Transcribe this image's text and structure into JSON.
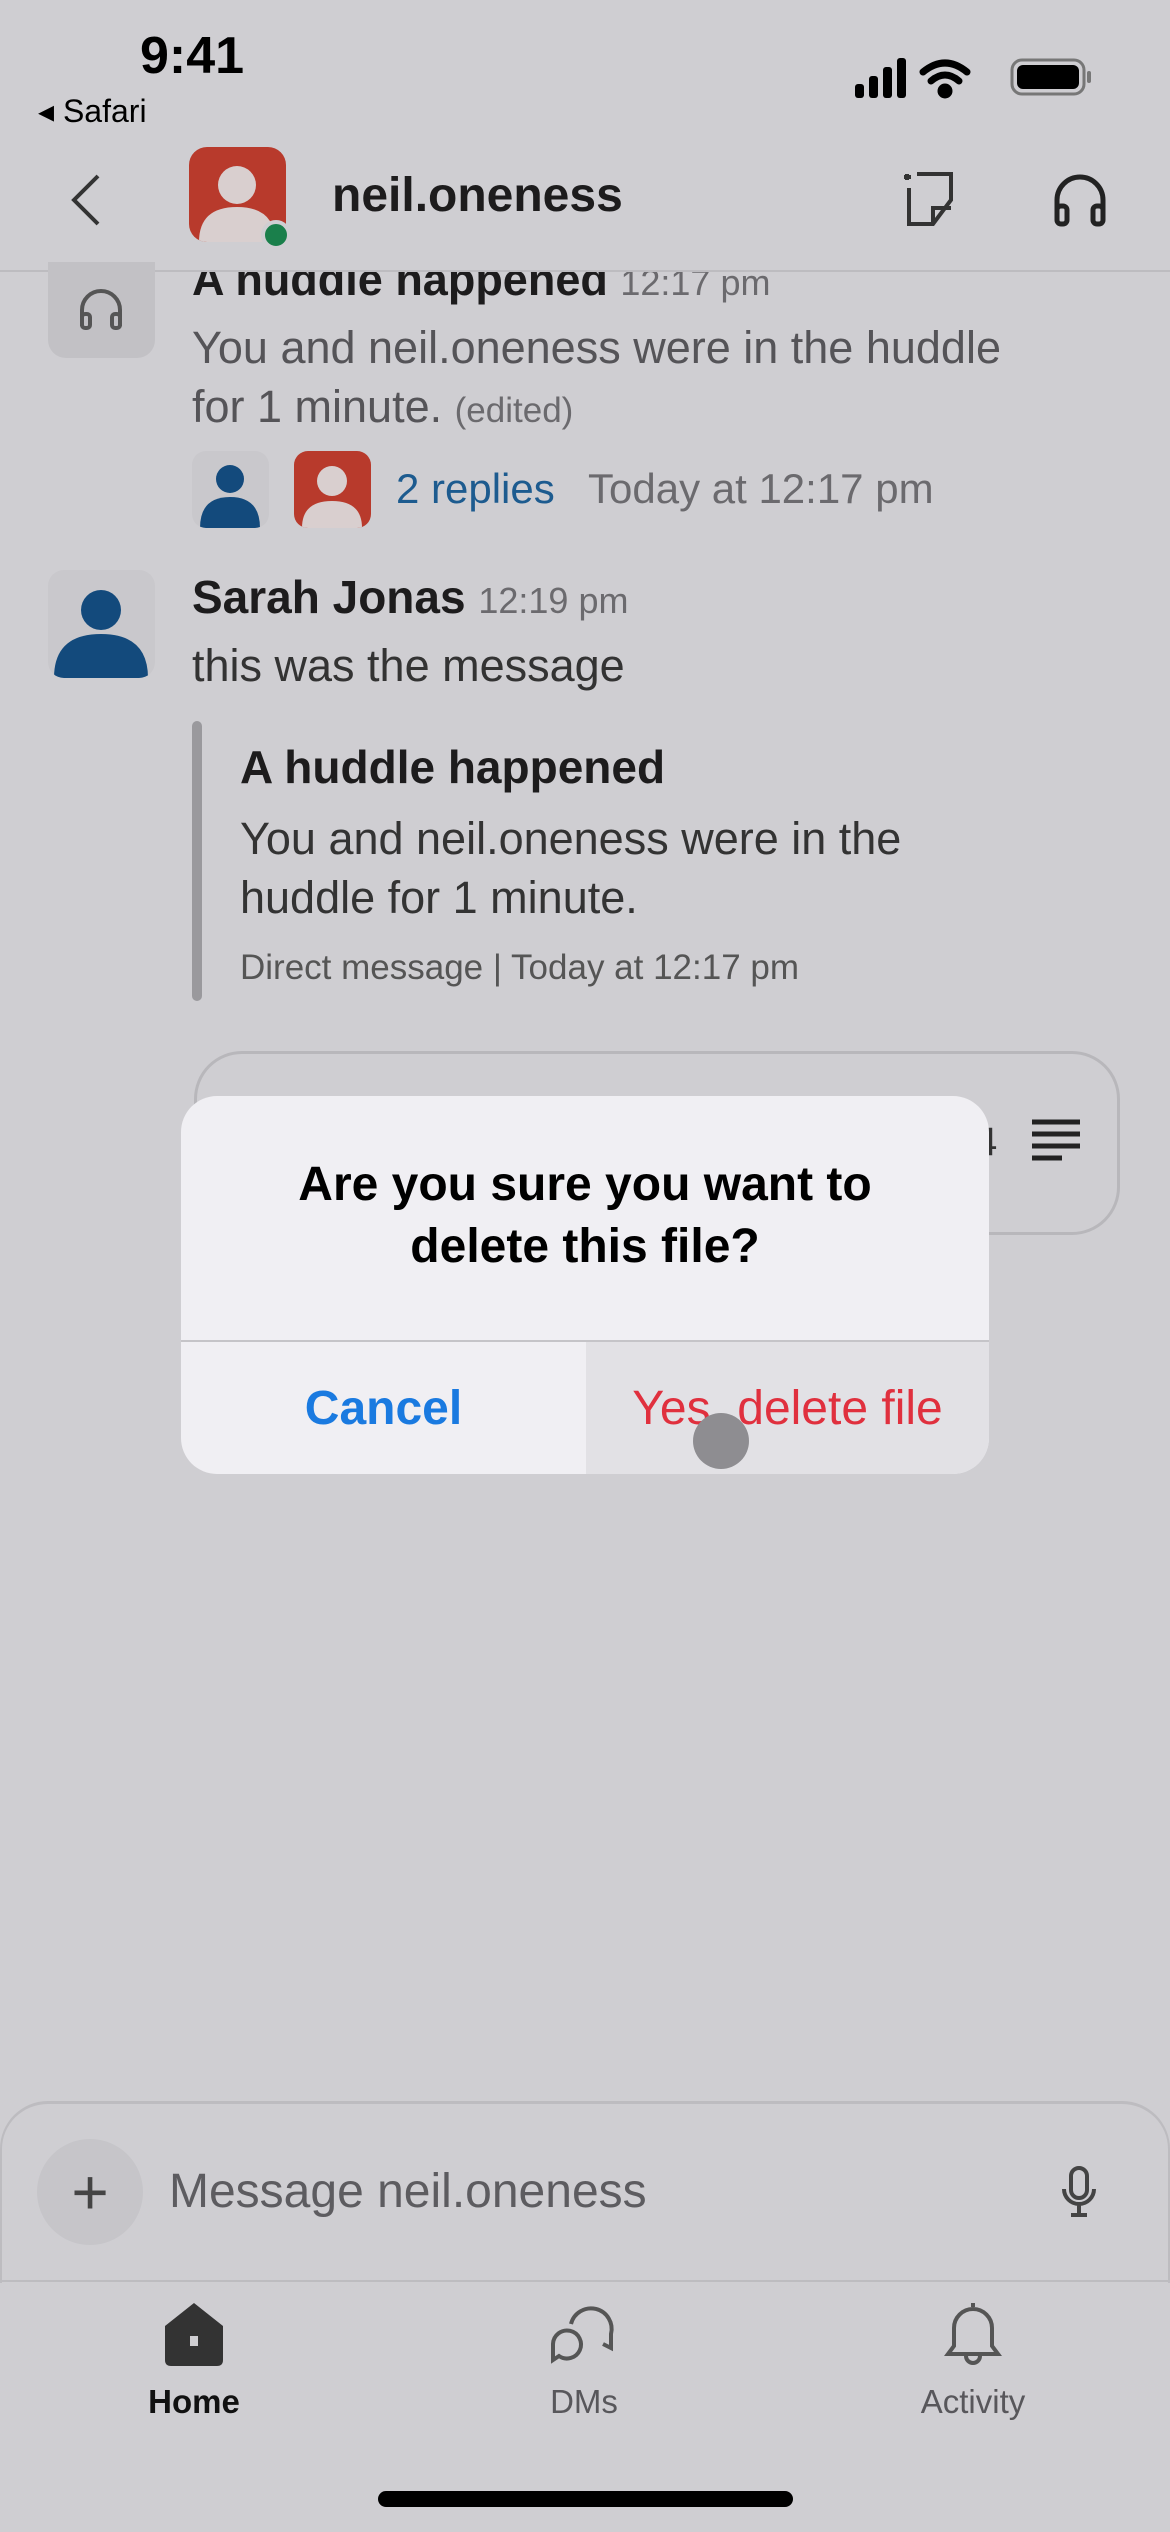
{
  "status_bar": {
    "time": "9:41",
    "back_app": "Safari"
  },
  "header": {
    "title": "neil.oneness",
    "presence": "online",
    "presence_color": "#1a7f4b",
    "icons": [
      "back-chevron-icon",
      "new-canvas-icon",
      "headphones-icon"
    ]
  },
  "messages": [
    {
      "title": "A huddle happened",
      "time": "12:17 pm",
      "text_line1": "You and neil.oneness were in the huddle",
      "text_line2": "for 1 minute.",
      "edited": "(edited)",
      "replies": "2 replies",
      "replies_time": "Today at 12:17 pm"
    },
    {
      "author": "Sarah Jonas",
      "time": "12:19 pm",
      "text": "this was the message",
      "quote": {
        "title": "A huddle happened",
        "line1": "You and neil.oneness were in the",
        "line2": "huddle for 1 minute.",
        "meta": "Direct message | Today at 12:17 pm"
      },
      "file_card_partial": "4"
    }
  ],
  "dialog": {
    "title_line1": "Are you sure you want to",
    "title_line2": "delete this file?",
    "cancel": "Cancel",
    "confirm": "Yes, delete file"
  },
  "composer": {
    "placeholder": "Message neil.oneness"
  },
  "tabs": [
    {
      "label": "Home",
      "active": true
    },
    {
      "label": "DMs",
      "active": false
    },
    {
      "label": "Activity",
      "active": false
    }
  ],
  "colors": {
    "accent_blue": "#1a7ae0",
    "destructive": "#e0303e",
    "link": "#1d5b8f",
    "avatar_red": "#b83a2c",
    "avatar_blue": "#134a7c"
  }
}
